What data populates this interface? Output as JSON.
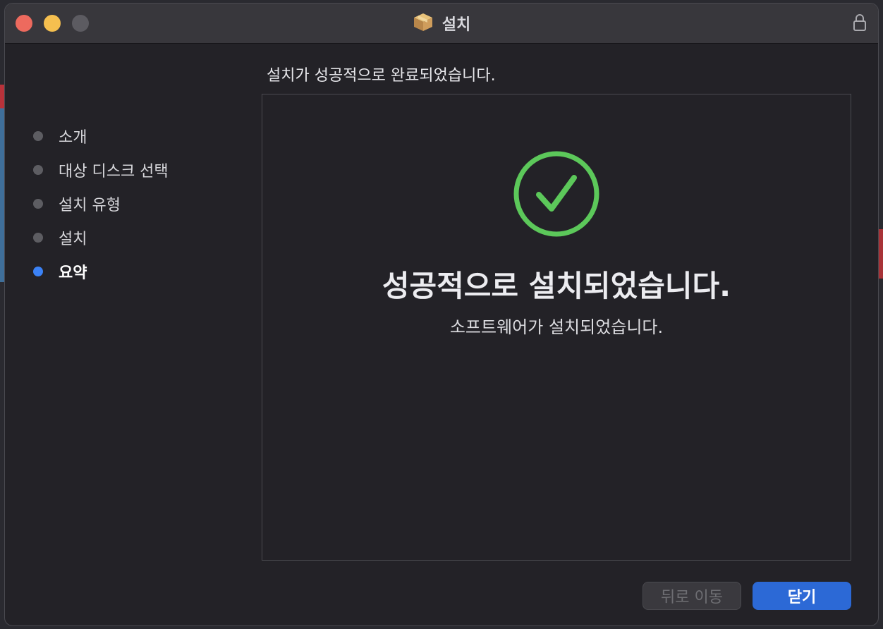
{
  "window": {
    "title": "설치"
  },
  "sidebar": {
    "steps": [
      {
        "label": "소개",
        "state": "done"
      },
      {
        "label": "대상 디스크 선택",
        "state": "done"
      },
      {
        "label": "설치 유형",
        "state": "done"
      },
      {
        "label": "설치",
        "state": "done"
      },
      {
        "label": "요약",
        "state": "current"
      }
    ]
  },
  "main": {
    "header": "설치가 성공적으로 완료되었습니다.",
    "success_title": "성공적으로 설치되었습니다.",
    "success_subtitle": "소프트웨어가 설치되었습니다."
  },
  "footer": {
    "back_label": "뒤로 이동",
    "close_label": "닫기"
  },
  "icons": {
    "title_icon": "package-icon",
    "lock": "lock-icon",
    "status": "success-check-icon"
  },
  "colors": {
    "accent": "#2c69d6",
    "active_dot": "#3b82f6",
    "success": "#5cc85a",
    "close_button": "#ed6a5e",
    "minimize_button": "#f5bf4f"
  }
}
